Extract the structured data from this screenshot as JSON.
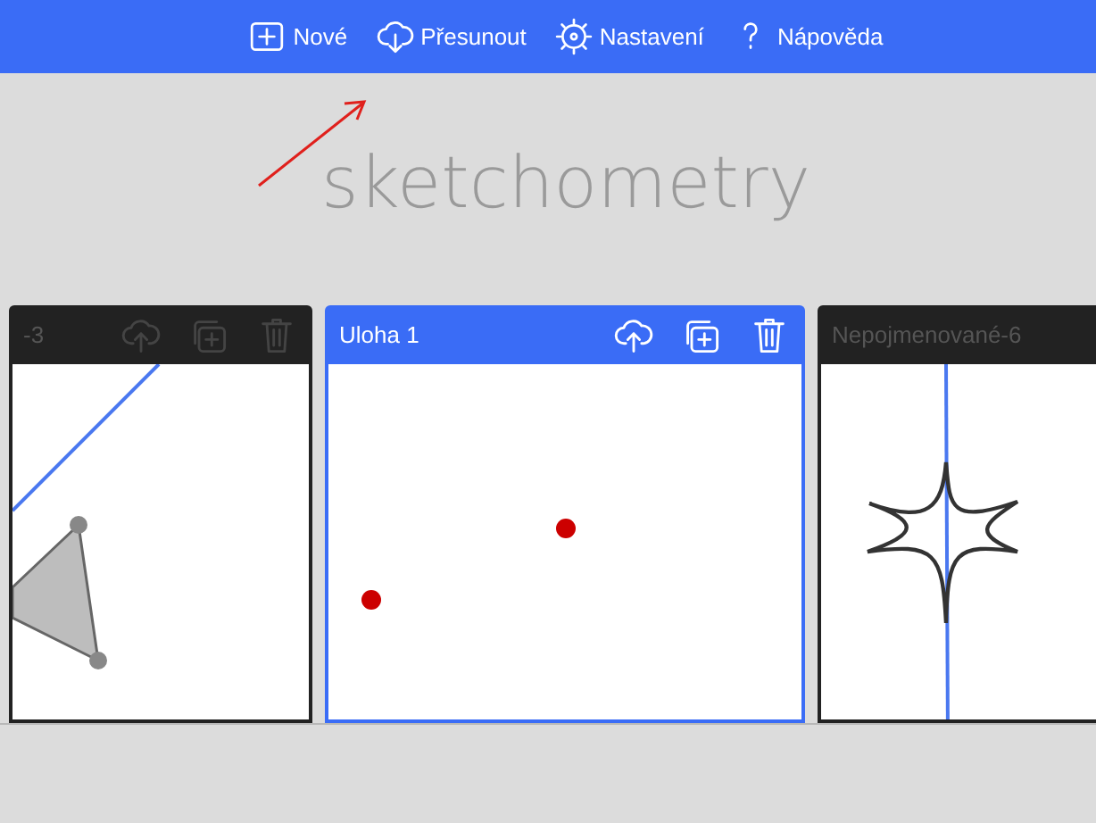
{
  "toolbar": [
    {
      "kind": "new",
      "label": "Nové"
    },
    {
      "kind": "move",
      "label": "Přesunout"
    },
    {
      "kind": "settings",
      "label": "Nastavení"
    },
    {
      "kind": "help",
      "label": "Nápověda"
    }
  ],
  "logo": "sketchometry",
  "cards": [
    {
      "title": "-3",
      "selected": false,
      "kind": "triangle",
      "actions": [
        {
          "kind": "upload"
        },
        {
          "kind": "duplicate"
        },
        {
          "kind": "delete"
        }
      ]
    },
    {
      "title": "Uloha 1",
      "selected": true,
      "kind": "points",
      "actions": [
        {
          "kind": "upload"
        },
        {
          "kind": "duplicate"
        },
        {
          "kind": "delete"
        }
      ]
    },
    {
      "title": "Nepojmenované-6",
      "selected": false,
      "kind": "star"
    }
  ]
}
